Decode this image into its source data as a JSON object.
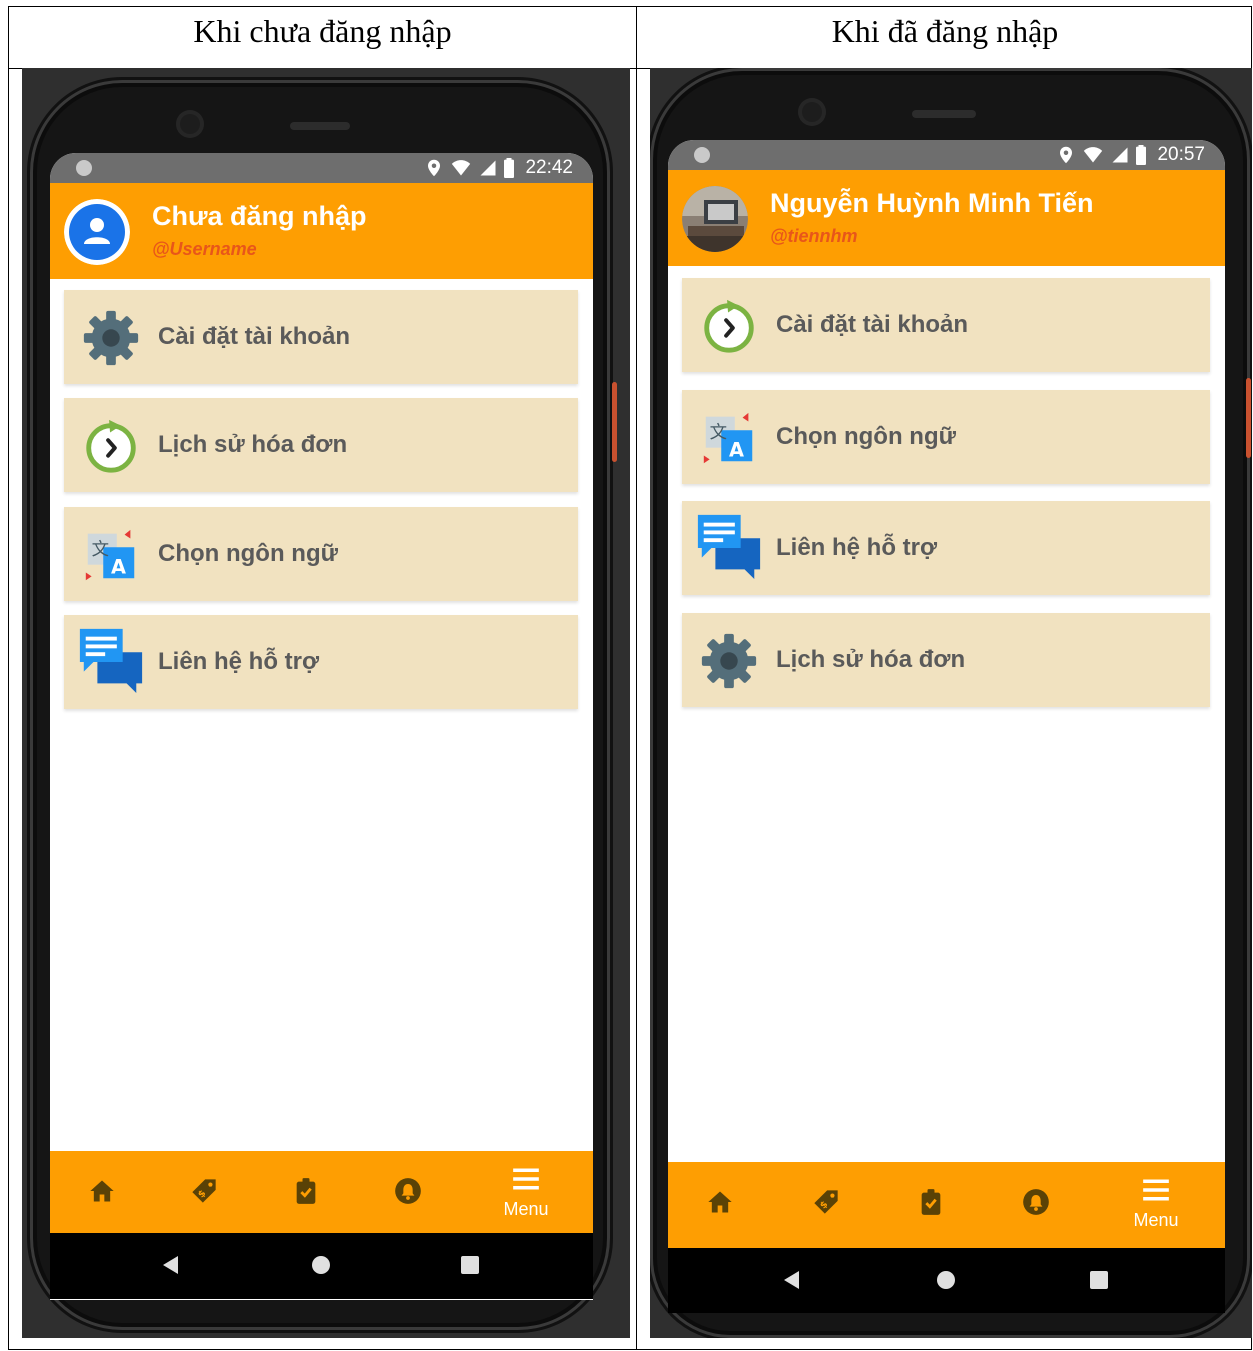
{
  "table": {
    "left_heading": "Khi chưa đăng nhập",
    "right_heading": "Khi đã đăng nhập"
  },
  "left_phone": {
    "status": {
      "time": "22:42"
    },
    "header": {
      "name": "Chưa đăng nhập",
      "username": "@Username"
    },
    "menu_items": [
      {
        "label": "Cài đặt tài khoản",
        "icon": "gear-icon"
      },
      {
        "label": "Lịch sử hóa đơn",
        "icon": "history-icon"
      },
      {
        "label": "Chọn ngôn ngữ",
        "icon": "translate-icon"
      },
      {
        "label": "Liên hệ hỗ trợ",
        "icon": "chat-icon"
      }
    ],
    "bottom_nav": {
      "menu_label": "Menu"
    }
  },
  "right_phone": {
    "status": {
      "time": "20:57"
    },
    "header": {
      "name": "Nguyễn Huỳnh Minh Tiến",
      "username": "@tiennhm"
    },
    "menu_items": [
      {
        "label": "Cài đặt tài khoản",
        "icon": "history-icon"
      },
      {
        "label": "Chọn ngôn ngữ",
        "icon": "translate-icon"
      },
      {
        "label": "Liên hệ hỗ trợ",
        "icon": "chat-icon"
      },
      {
        "label": "Lịch sử hóa đơn",
        "icon": "gear-icon"
      }
    ],
    "bottom_nav": {
      "menu_label": "Menu"
    }
  },
  "colors": {
    "accent": "#fe9e02",
    "item_background": "#f1e2c0",
    "username_color": "#e8561a",
    "item_text": "#5a5a5a"
  }
}
